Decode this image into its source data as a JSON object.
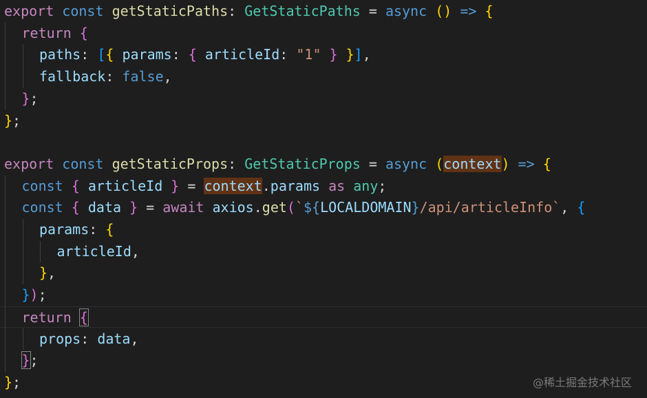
{
  "editor": {
    "lines": [
      {
        "indent": 0,
        "tokens": [
          {
            "t": "export",
            "c": "kw-ctrl"
          },
          {
            "t": " ",
            "c": "punc"
          },
          {
            "t": "const",
            "c": "kw"
          },
          {
            "t": " ",
            "c": "punc"
          },
          {
            "t": "getStaticPaths",
            "c": "fn"
          },
          {
            "t": ": ",
            "c": "punc"
          },
          {
            "t": "GetStaticPaths",
            "c": "type"
          },
          {
            "t": " = ",
            "c": "punc"
          },
          {
            "t": "async",
            "c": "kw"
          },
          {
            "t": " ",
            "c": "punc"
          },
          {
            "t": "()",
            "c": "br1"
          },
          {
            "t": " ",
            "c": "punc"
          },
          {
            "t": "=>",
            "c": "kw"
          },
          {
            "t": " ",
            "c": "punc"
          },
          {
            "t": "{",
            "c": "br1"
          }
        ]
      },
      {
        "indent": 1,
        "tokens": [
          {
            "t": "return",
            "c": "kw-ctrl"
          },
          {
            "t": " ",
            "c": "punc"
          },
          {
            "t": "{",
            "c": "br2"
          }
        ]
      },
      {
        "indent": 2,
        "tokens": [
          {
            "t": "paths",
            "c": "var"
          },
          {
            "t": ": ",
            "c": "punc"
          },
          {
            "t": "[",
            "c": "br3"
          },
          {
            "t": "{",
            "c": "br1"
          },
          {
            "t": " ",
            "c": "punc"
          },
          {
            "t": "params",
            "c": "var"
          },
          {
            "t": ": ",
            "c": "punc"
          },
          {
            "t": "{",
            "c": "br2"
          },
          {
            "t": " ",
            "c": "punc"
          },
          {
            "t": "articleId",
            "c": "var"
          },
          {
            "t": ": ",
            "c": "punc"
          },
          {
            "t": "\"1\"",
            "c": "str"
          },
          {
            "t": " ",
            "c": "punc"
          },
          {
            "t": "}",
            "c": "br2"
          },
          {
            "t": " ",
            "c": "punc"
          },
          {
            "t": "}",
            "c": "br1"
          },
          {
            "t": "]",
            "c": "br3"
          },
          {
            "t": ",",
            "c": "punc"
          }
        ]
      },
      {
        "indent": 2,
        "tokens": [
          {
            "t": "fallback",
            "c": "var"
          },
          {
            "t": ": ",
            "c": "punc"
          },
          {
            "t": "false",
            "c": "kw"
          },
          {
            "t": ",",
            "c": "punc"
          }
        ]
      },
      {
        "indent": 1,
        "tokens": [
          {
            "t": "}",
            "c": "br2"
          },
          {
            "t": ";",
            "c": "punc"
          }
        ]
      },
      {
        "indent": 0,
        "tokens": [
          {
            "t": "}",
            "c": "br1"
          },
          {
            "t": ";",
            "c": "punc"
          }
        ]
      },
      {
        "indent": 0,
        "tokens": []
      },
      {
        "indent": 0,
        "tokens": [
          {
            "t": "export",
            "c": "kw-ctrl"
          },
          {
            "t": " ",
            "c": "punc"
          },
          {
            "t": "const",
            "c": "kw"
          },
          {
            "t": " ",
            "c": "punc"
          },
          {
            "t": "getStaticProps",
            "c": "fn"
          },
          {
            "t": ": ",
            "c": "punc"
          },
          {
            "t": "GetStaticProps",
            "c": "type"
          },
          {
            "t": " = ",
            "c": "punc"
          },
          {
            "t": "async",
            "c": "kw"
          },
          {
            "t": " ",
            "c": "punc"
          },
          {
            "t": "(",
            "c": "br1"
          },
          {
            "t": "context",
            "c": "var hl"
          },
          {
            "t": ")",
            "c": "br1"
          },
          {
            "t": " ",
            "c": "punc"
          },
          {
            "t": "=>",
            "c": "kw"
          },
          {
            "t": " ",
            "c": "punc"
          },
          {
            "t": "{",
            "c": "br1"
          }
        ]
      },
      {
        "indent": 1,
        "tokens": [
          {
            "t": "const",
            "c": "kw"
          },
          {
            "t": " ",
            "c": "punc"
          },
          {
            "t": "{",
            "c": "br2"
          },
          {
            "t": " ",
            "c": "punc"
          },
          {
            "t": "articleId",
            "c": "var"
          },
          {
            "t": " ",
            "c": "punc"
          },
          {
            "t": "}",
            "c": "br2"
          },
          {
            "t": " = ",
            "c": "punc"
          },
          {
            "t": "context",
            "c": "var hl"
          },
          {
            "t": ".",
            "c": "punc"
          },
          {
            "t": "params",
            "c": "var"
          },
          {
            "t": " ",
            "c": "punc"
          },
          {
            "t": "as",
            "c": "kw-ctrl"
          },
          {
            "t": " ",
            "c": "punc"
          },
          {
            "t": "any",
            "c": "type"
          },
          {
            "t": ";",
            "c": "punc"
          }
        ]
      },
      {
        "indent": 1,
        "tokens": [
          {
            "t": "const",
            "c": "kw"
          },
          {
            "t": " ",
            "c": "punc"
          },
          {
            "t": "{",
            "c": "br2"
          },
          {
            "t": " ",
            "c": "punc"
          },
          {
            "t": "data",
            "c": "var"
          },
          {
            "t": " ",
            "c": "punc"
          },
          {
            "t": "}",
            "c": "br2"
          },
          {
            "t": " = ",
            "c": "punc"
          },
          {
            "t": "await",
            "c": "kw-ctrl"
          },
          {
            "t": " ",
            "c": "punc"
          },
          {
            "t": "axios",
            "c": "var"
          },
          {
            "t": ".",
            "c": "punc"
          },
          {
            "t": "get",
            "c": "fn"
          },
          {
            "t": "(",
            "c": "br2"
          },
          {
            "t": "`",
            "c": "str"
          },
          {
            "t": "${",
            "c": "kw"
          },
          {
            "t": "LOCALDOMAIN",
            "c": "var"
          },
          {
            "t": "}",
            "c": "kw"
          },
          {
            "t": "/api/articleInfo`",
            "c": "str"
          },
          {
            "t": ", ",
            "c": "punc"
          },
          {
            "t": "{",
            "c": "br3"
          }
        ]
      },
      {
        "indent": 2,
        "tokens": [
          {
            "t": "params",
            "c": "var"
          },
          {
            "t": ": ",
            "c": "punc"
          },
          {
            "t": "{",
            "c": "br1"
          }
        ]
      },
      {
        "indent": 3,
        "tokens": [
          {
            "t": "articleId",
            "c": "var"
          },
          {
            "t": ",",
            "c": "punc"
          }
        ]
      },
      {
        "indent": 2,
        "tokens": [
          {
            "t": "}",
            "c": "br1"
          },
          {
            "t": ",",
            "c": "punc"
          }
        ]
      },
      {
        "indent": 1,
        "tokens": [
          {
            "t": "}",
            "c": "br3"
          },
          {
            "t": ")",
            "c": "br2"
          },
          {
            "t": ";",
            "c": "punc"
          }
        ]
      },
      {
        "indent": 1,
        "current": true,
        "tokens": [
          {
            "t": "return",
            "c": "kw-ctrl"
          },
          {
            "t": " ",
            "c": "punc"
          },
          {
            "t": "{",
            "c": "br2 match"
          }
        ]
      },
      {
        "indent": 2,
        "tokens": [
          {
            "t": "props",
            "c": "var"
          },
          {
            "t": ": ",
            "c": "punc"
          },
          {
            "t": "data",
            "c": "var"
          },
          {
            "t": ",",
            "c": "punc"
          }
        ]
      },
      {
        "indent": 1,
        "tokens": [
          {
            "t": "}",
            "c": "br2 match"
          },
          {
            "t": ";",
            "c": "punc"
          }
        ]
      },
      {
        "indent": 0,
        "tokens": [
          {
            "t": "}",
            "c": "br1"
          },
          {
            "t": ";",
            "c": "punc"
          }
        ]
      }
    ]
  },
  "watermark": "@稀土掘金技术社区"
}
